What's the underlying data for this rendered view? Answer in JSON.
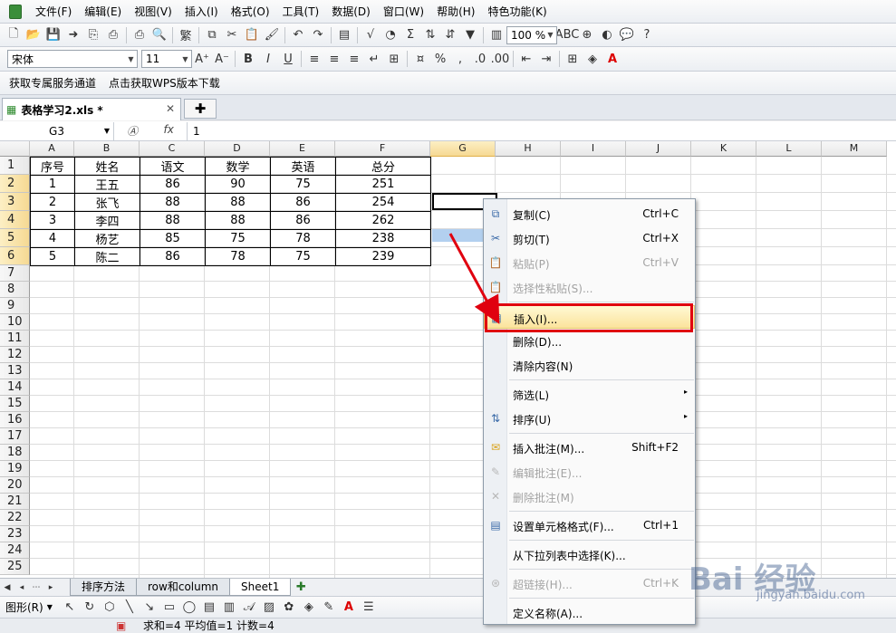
{
  "menubar": [
    "文件(F)",
    "编辑(E)",
    "视图(V)",
    "插入(I)",
    "格式(O)",
    "工具(T)",
    "数据(D)",
    "窗口(W)",
    "帮助(H)",
    "特色功能(K)"
  ],
  "toolbar": {
    "zoom": "100 %"
  },
  "format": {
    "font": "宋体",
    "size": "11",
    "bold": "B",
    "italic": "I",
    "underline": "U"
  },
  "links": [
    "获取专属服务通道",
    "点击获取WPS版本下载"
  ],
  "doc_tab": "表格学习2.xls *",
  "formula": {
    "cell": "G3",
    "fx": "fx",
    "value": "1"
  },
  "columns": [
    "A",
    "B",
    "C",
    "D",
    "E",
    "F",
    "G",
    "H",
    "I",
    "J",
    "K",
    "L",
    "M"
  ],
  "rows": [
    "1",
    "2",
    "3",
    "4",
    "5",
    "6",
    "7",
    "8",
    "9",
    "10",
    "11",
    "12",
    "13",
    "14",
    "15",
    "16",
    "17",
    "18",
    "19",
    "20",
    "21",
    "22",
    "23",
    "24",
    "25"
  ],
  "table": [
    [
      "序号",
      "姓名",
      "语文",
      "数学",
      "英语",
      "总分"
    ],
    [
      "1",
      "王五",
      "86",
      "90",
      "75",
      "251"
    ],
    [
      "2",
      "张飞",
      "88",
      "88",
      "86",
      "254"
    ],
    [
      "3",
      "李四",
      "88",
      "88",
      "86",
      "262"
    ],
    [
      "4",
      "杨艺",
      "85",
      "75",
      "78",
      "238"
    ],
    [
      "5",
      "陈二",
      "86",
      "78",
      "75",
      "239"
    ]
  ],
  "context_menu": {
    "copy": {
      "label": "复制(C)",
      "shortcut": "Ctrl+C"
    },
    "cut": {
      "label": "剪切(T)",
      "shortcut": "Ctrl+X"
    },
    "paste": {
      "label": "粘贴(P)",
      "shortcut": "Ctrl+V"
    },
    "paste_special": {
      "label": "选择性粘贴(S)..."
    },
    "insert": {
      "label": "插入(I)..."
    },
    "delete": {
      "label": "删除(D)..."
    },
    "clear": {
      "label": "清除内容(N)"
    },
    "filter": {
      "label": "筛选(L)"
    },
    "sort": {
      "label": "排序(U)"
    },
    "insert_comment": {
      "label": "插入批注(M)...",
      "shortcut": "Shift+F2"
    },
    "edit_comment": {
      "label": "编辑批注(E)..."
    },
    "delete_comment": {
      "label": "删除批注(M)"
    },
    "format_cells": {
      "label": "设置单元格格式(F)...",
      "shortcut": "Ctrl+1"
    },
    "pick_list": {
      "label": "从下拉列表中选择(K)..."
    },
    "hyperlink": {
      "label": "超链接(H)...",
      "shortcut": "Ctrl+K"
    },
    "define_name": {
      "label": "定义名称(A)..."
    }
  },
  "sheets": [
    "排序方法",
    "row和column",
    "Sheet1"
  ],
  "drawbar": {
    "shapes": "图形(R)"
  },
  "status": "求和=4  平均值=1  计数=4",
  "watermark": {
    "brand": "Bai 经验",
    "url": "jingyan.baidu.com"
  },
  "colors": {
    "highlight_red": "#e0000f",
    "selection_blue": "#b3d0ef",
    "header_selected": "#f6d993"
  }
}
